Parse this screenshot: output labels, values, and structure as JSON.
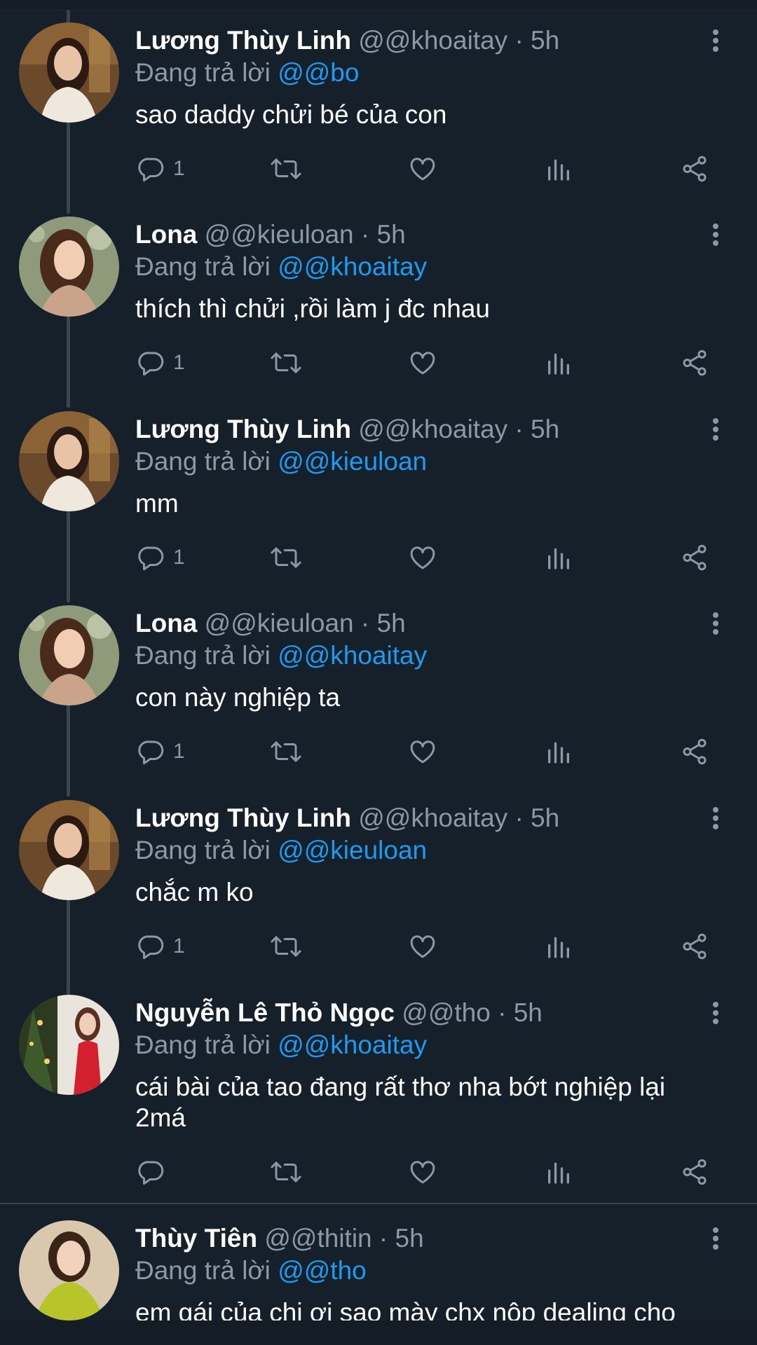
{
  "reply_prefix": "Đang trả lời",
  "tweets": [
    {
      "name": "Lương Thùy Linh",
      "handle": "@@khoaitay",
      "time": "· 5h",
      "reply_to": "@@bo",
      "text": "sao daddy chửi bé của con",
      "reply_count": "1",
      "avatar": "linh-photo"
    },
    {
      "name": "Lona",
      "handle": "@@kieuloan",
      "time": "· 5h",
      "reply_to": "@@khoaitay",
      "text": "thích thì chửi ,rồi làm j đc nhau",
      "reply_count": "1",
      "avatar": "lona-photo"
    },
    {
      "name": "Lương Thùy Linh",
      "handle": "@@khoaitay",
      "time": "· 5h",
      "reply_to": "@@kieuloan",
      "text": "mm",
      "reply_count": "1",
      "avatar": "linh-photo"
    },
    {
      "name": "Lona",
      "handle": "@@kieuloan",
      "time": "· 5h",
      "reply_to": "@@khoaitay",
      "text": "con này nghiệp ta",
      "reply_count": "1",
      "avatar": "lona-photo"
    },
    {
      "name": "Lương Thùy Linh",
      "handle": "@@khoaitay",
      "time": "· 5h",
      "reply_to": "@@kieuloan",
      "text": "chắc m ko",
      "reply_count": "1",
      "avatar": "linh-photo"
    },
    {
      "name": "Nguyễn Lê Thỏ Ngọc",
      "handle": "@@tho",
      "time": "· 5h",
      "reply_to": "@@khoaitay",
      "text": "cái bài của tao đang rất thơ nha bớt nghiệp lại 2má",
      "reply_count": "",
      "avatar": "ngoc-photo"
    },
    {
      "name": "Thùy Tiên",
      "handle": "@@thitin",
      "time": "· 5h",
      "reply_to": "@@tho",
      "text": "em gái của chị ơi sao mày chx nộp dealing cho",
      "reply_count": "",
      "avatar": "tien-photo"
    }
  ],
  "icons": {
    "reply": "reply-icon",
    "retweet": "retweet-icon",
    "like": "heart-icon",
    "views": "views-icon",
    "share": "share-icon",
    "more": "more-icon"
  },
  "colors": {
    "background": "#15202b",
    "secondary_text": "#8b98a5",
    "link": "#1d9bf0",
    "thread_line": "#3a444e"
  }
}
